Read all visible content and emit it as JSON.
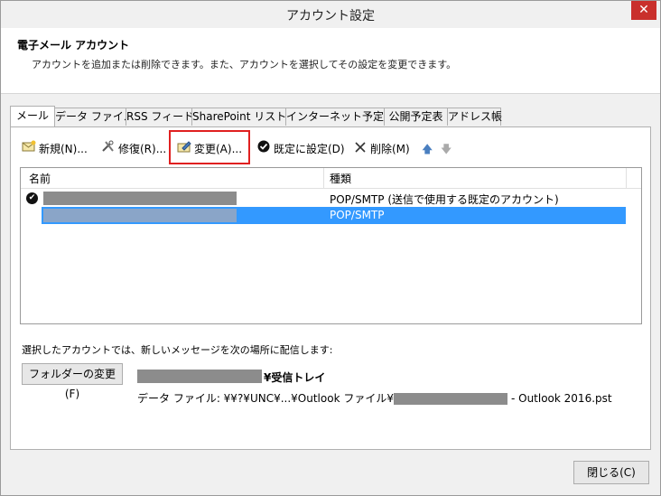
{
  "window": {
    "title": "アカウント設定",
    "close_glyph": "✕"
  },
  "header": {
    "title": "電子メール アカウント",
    "description": "アカウントを追加または削除できます。また、アカウントを選択してその設定を変更できます。"
  },
  "tabs": [
    {
      "label": "メール",
      "active": true
    },
    {
      "label": "データ ファイル"
    },
    {
      "label": "RSS フィード"
    },
    {
      "label": "SharePoint リスト"
    },
    {
      "label": "インターネット予定表"
    },
    {
      "label": "公開予定表"
    },
    {
      "label": "アドレス帳"
    }
  ],
  "toolbar": {
    "new_label": "新規(N)...",
    "repair_label": "修復(R)...",
    "change_label": "変更(A)...",
    "default_label": "既定に設定(D)",
    "delete_label": "削除(M)",
    "up_glyph": "🡅",
    "down_glyph": "🡇"
  },
  "list": {
    "col_name": "名前",
    "col_type": "種類",
    "rows": [
      {
        "type": "POP/SMTP (送信で使用する既定のアカウント)",
        "default": true,
        "selected": false
      },
      {
        "type": "POP/SMTP",
        "default": false,
        "selected": true
      }
    ]
  },
  "delivery": {
    "text": "選択したアカウントでは、新しいメッセージを次の場所に配信します:",
    "change_folder_button": "フォルダーの変更(F)",
    "inbox_suffix": "¥受信トレイ",
    "data_file_prefix": "データ ファイル: ¥¥?¥UNC¥...¥Outlook ファイル¥",
    "data_file_suffix": "- Outlook 2016.pst"
  },
  "footer": {
    "close_button": "閉じる(C)"
  },
  "colors": {
    "selection": "#3399ff",
    "highlight_box": "#e02020",
    "redaction": "#8c8c8c"
  }
}
